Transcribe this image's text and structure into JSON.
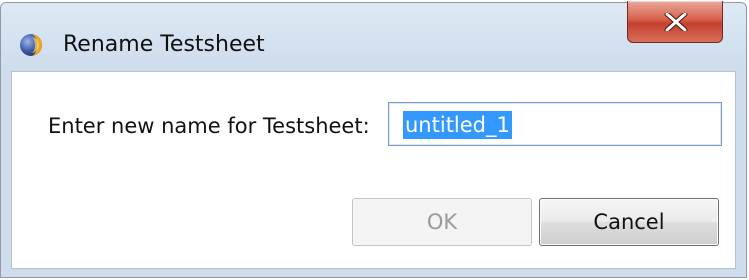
{
  "window": {
    "title": "Rename Testsheet",
    "app_icon": "eclipse-sphere-icon",
    "close_icon": "close-x-icon"
  },
  "form": {
    "prompt_label": "Enter new name for Testsheet:",
    "name_value": "untitled_1",
    "name_selected": true
  },
  "buttons": {
    "ok_label": "OK",
    "ok_enabled": false,
    "cancel_label": "Cancel"
  },
  "colors": {
    "selection": "#3399ff",
    "close_button": "#c3402b",
    "titlebar": "#d6e3f1"
  }
}
